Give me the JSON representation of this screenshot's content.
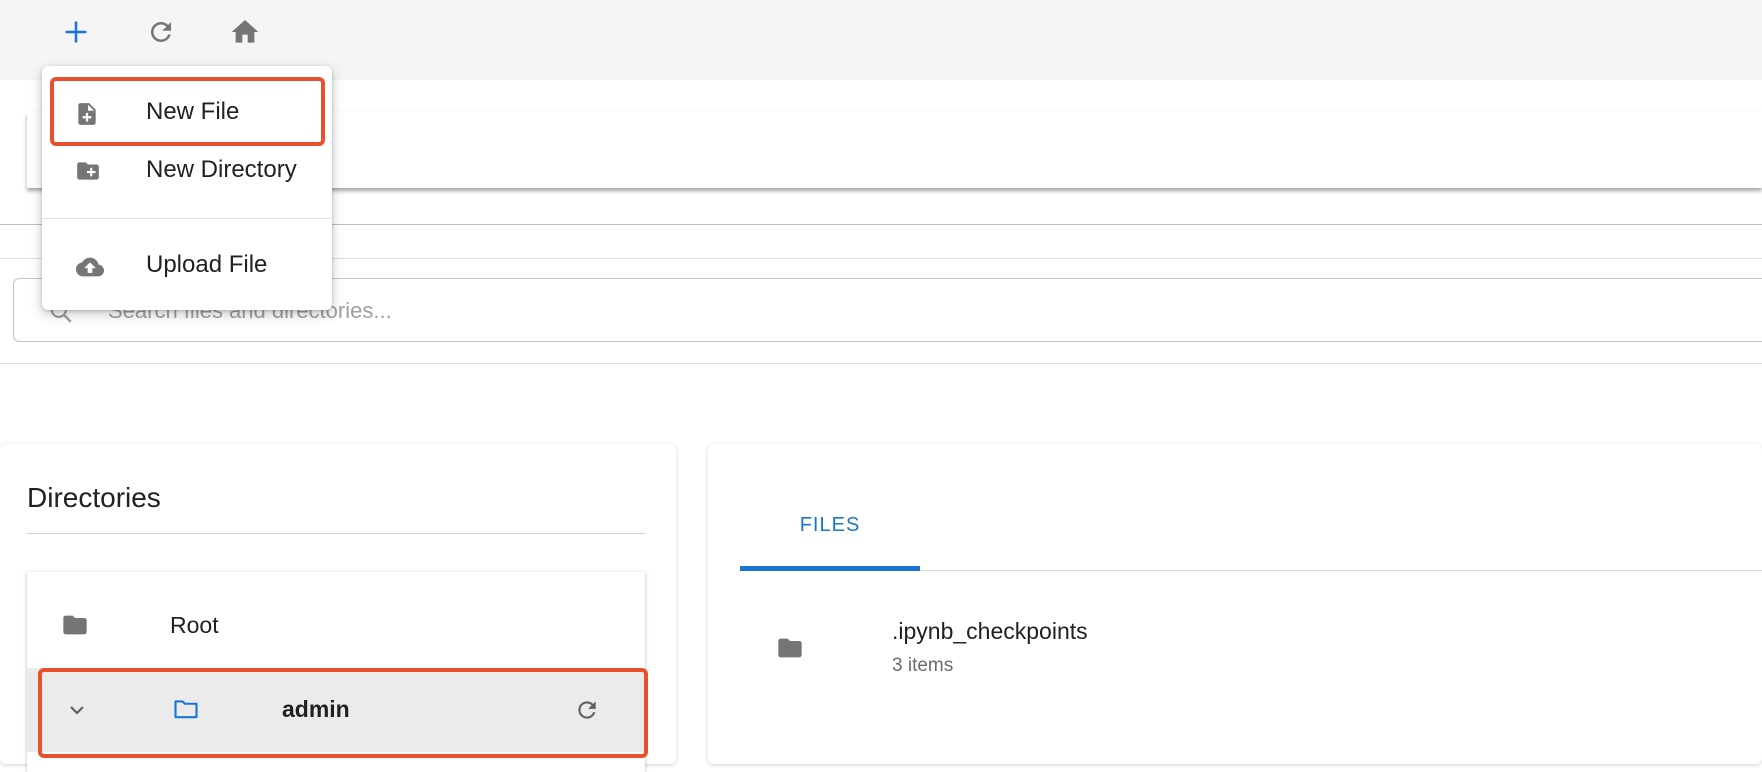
{
  "toolbar": {
    "add_icon": "plus-icon",
    "refresh_icon": "refresh-icon",
    "home_icon": "home-icon"
  },
  "search": {
    "placeholder": "Search files and directories..."
  },
  "menu": {
    "items": [
      {
        "label": "New File",
        "icon": "file-plus-icon"
      },
      {
        "label": "New Directory",
        "icon": "folder-plus-icon"
      },
      {
        "label": "Upload File",
        "icon": "cloud-upload-icon"
      }
    ]
  },
  "directories": {
    "title": "Directories",
    "items": [
      {
        "label": "Root",
        "icon": "folder-icon"
      },
      {
        "label": "admin",
        "icon": "folder-open-icon",
        "selected": true
      }
    ]
  },
  "files": {
    "tab_label": "FILES",
    "items": [
      {
        "name": ".ipynb_checkpoints",
        "meta": "3 items",
        "icon": "folder-icon"
      }
    ]
  },
  "colors": {
    "accent": "#1976d2",
    "highlight": "#e8502e",
    "icon_gray": "#757575"
  }
}
